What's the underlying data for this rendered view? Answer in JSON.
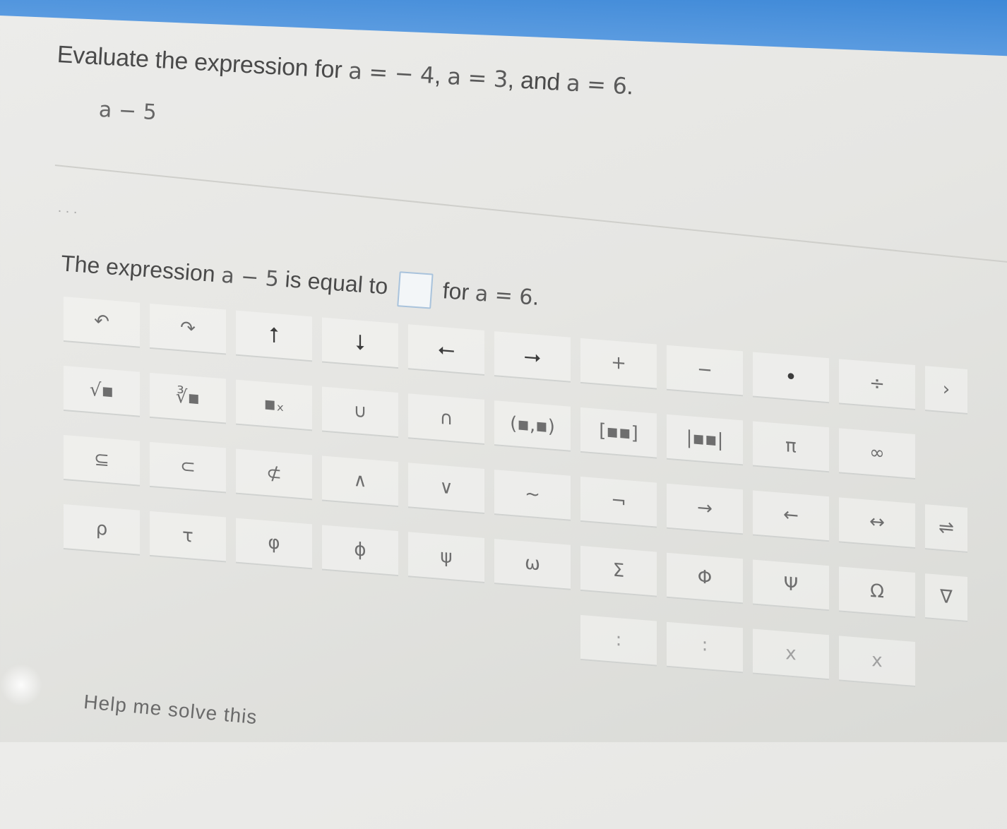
{
  "problem": {
    "prompt_prefix": "Evaluate the expression for ",
    "val1": "a = − 4",
    "sep1": ", ",
    "val2": "a = 3",
    "sep2": ", and ",
    "val3": "a = 6",
    "end": "."
  },
  "expression": "a − 5",
  "dots": ". . .",
  "answer": {
    "prefix": "The expression ",
    "expr": "a − 5",
    "middle": " is equal to ",
    "suffix": " for ",
    "cond": "a = 6",
    "end": ".",
    "input_value": ""
  },
  "keypad": {
    "rows": [
      [
        "↶",
        "↷",
        "⭡",
        "⭣",
        "⭠",
        "⭢",
        "+",
        "−",
        "•",
        "÷"
      ],
      [
        "√▪",
        "∛▪",
        "▪ₓ",
        "∪",
        "∩",
        "(▪,▪)",
        "[▪▪]",
        "|▪▪|",
        "π",
        "∞"
      ],
      [
        "⊆",
        "⊂",
        "⊄",
        "∧",
        "∨",
        "~",
        "¬",
        "→",
        "←",
        "↔"
      ],
      [
        "ρ",
        "τ",
        "φ",
        "ϕ",
        "ψ",
        "ω",
        "Σ",
        "Φ",
        "Ψ",
        "Ω"
      ],
      [
        "",
        "",
        "",
        "",
        "",
        "",
        ":",
        "∶",
        "x",
        "x"
      ]
    ],
    "edge_keys": [
      "›",
      "⇌",
      "∇"
    ]
  },
  "help_link": "Help me solve this"
}
